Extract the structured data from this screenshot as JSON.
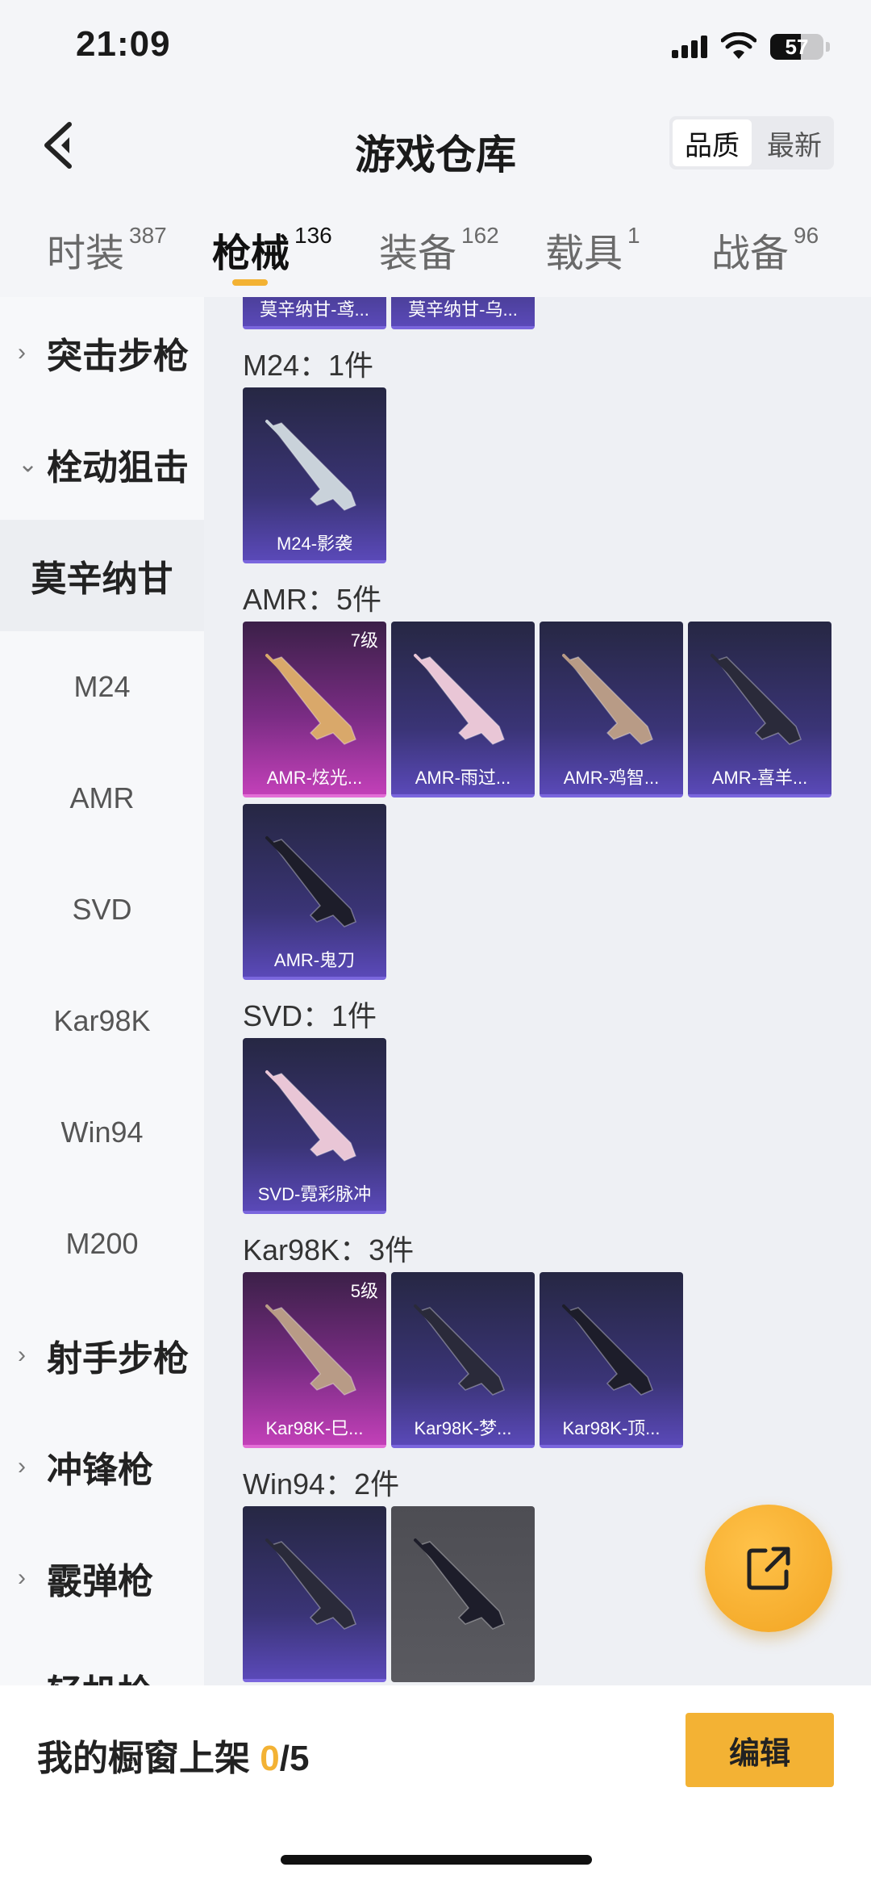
{
  "status_bar": {
    "time": "21:09",
    "battery": "57",
    "battery_level": 0.57
  },
  "nav": {
    "title": "游戏仓库",
    "sort_options": [
      "品质",
      "最新"
    ],
    "active_sort": "品质"
  },
  "tabs": [
    {
      "label": "时装",
      "count": "387"
    },
    {
      "label": "枪械",
      "count": "136",
      "active": true
    },
    {
      "label": "装备",
      "count": "162"
    },
    {
      "label": "载具",
      "count": "1"
    },
    {
      "label": "战备",
      "count": "96"
    }
  ],
  "sidebar": [
    {
      "label": "突击步枪",
      "type": "group",
      "expanded": false
    },
    {
      "label": "栓动狙击",
      "type": "group",
      "expanded": true
    },
    {
      "label": "莫辛纳甘",
      "type": "sub",
      "selected": true
    },
    {
      "label": "M24",
      "type": "sub"
    },
    {
      "label": "AMR",
      "type": "sub"
    },
    {
      "label": "SVD",
      "type": "sub"
    },
    {
      "label": "Kar98K",
      "type": "sub"
    },
    {
      "label": "Win94",
      "type": "sub"
    },
    {
      "label": "M200",
      "type": "sub"
    },
    {
      "label": "射手步枪",
      "type": "group",
      "expanded": false
    },
    {
      "label": "冲锋枪",
      "type": "group",
      "expanded": false
    },
    {
      "label": "霰弹枪",
      "type": "group",
      "expanded": false
    },
    {
      "label": "轻机枪",
      "type": "group",
      "expanded": false
    }
  ],
  "sections": [
    {
      "title": "",
      "items": [
        {
          "name": "莫辛纳甘-鸢...",
          "rarity": "purple"
        },
        {
          "name": "莫辛纳甘-乌...",
          "rarity": "purple"
        }
      ]
    },
    {
      "title": "M24：1件",
      "items": [
        {
          "name": "M24-影袭",
          "rarity": "purple"
        }
      ]
    },
    {
      "title": "AMR：5件",
      "items": [
        {
          "name": "AMR-炫光...",
          "rarity": "pink",
          "level": "7级"
        },
        {
          "name": "AMR-雨过...",
          "rarity": "purple"
        },
        {
          "name": "AMR-鸡智...",
          "rarity": "purple"
        },
        {
          "name": "AMR-喜羊...",
          "rarity": "purple"
        },
        {
          "name": "AMR-鬼刀",
          "rarity": "purple"
        }
      ]
    },
    {
      "title": "SVD：1件",
      "items": [
        {
          "name": "SVD-霓彩脉冲",
          "rarity": "purple"
        }
      ]
    },
    {
      "title": "Kar98K：3件",
      "items": [
        {
          "name": "Kar98K-巳...",
          "rarity": "pink",
          "level": "5级"
        },
        {
          "name": "Kar98K-梦...",
          "rarity": "purple"
        },
        {
          "name": "Kar98K-顶...",
          "rarity": "purple"
        }
      ]
    },
    {
      "title": "Win94：2件",
      "items": [
        {
          "name": "",
          "rarity": "purple"
        },
        {
          "name": "",
          "rarity": "gray"
        }
      ]
    }
  ],
  "bottom": {
    "showcase_label": "我的橱窗上架",
    "showcase_count": "0",
    "showcase_total": "/5",
    "edit_label": "编辑"
  },
  "colors": {
    "accent": "#f3b234",
    "purple_card": "#3a3476",
    "pink_card": "#7a2c84"
  }
}
